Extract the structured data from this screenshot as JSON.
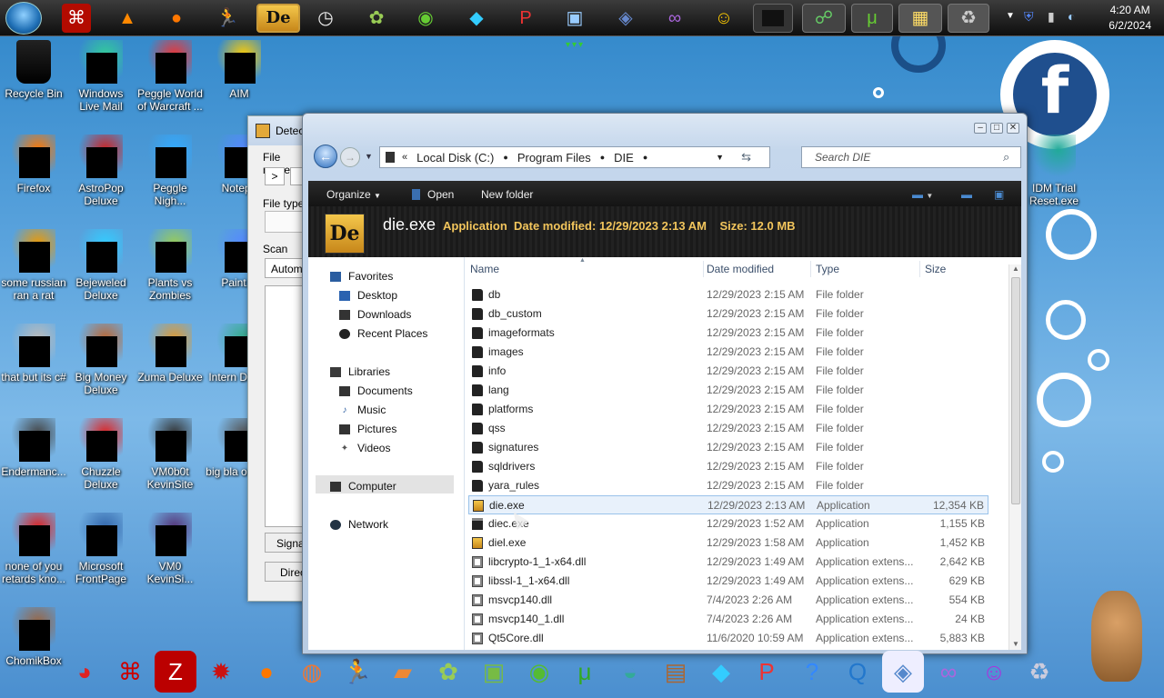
{
  "taskbar": {
    "time": "4:20 AM",
    "date": "6/2/2024",
    "icons": [
      "windows-orb-icon",
      "acrobat-icon",
      "vlc-icon",
      "firefox-icon",
      "aim-icon",
      "die-icon",
      "clock-icon",
      "plants-vs-zombies-icon",
      "windows-icon",
      "bejeweled-icon",
      "peggle-icon",
      "paint-icon",
      "frontpage-icon",
      "visual-studio-icon",
      "yahoo-messenger-icon",
      "terminal-icon",
      "users-icon",
      "utorrent-icon",
      "control-panel-icon",
      "recycle-icon"
    ]
  },
  "desktop_icons": [
    {
      "label": "Recycle Bin",
      "name": "recycle-bin"
    },
    {
      "label": "Windows Live Mail",
      "name": "windows-live-mail"
    },
    {
      "label": "Peggle World of Warcraft ...",
      "name": "peggle-wow"
    },
    {
      "label": "AIM",
      "name": "aim"
    },
    {
      "label": "Firefox",
      "name": "firefox"
    },
    {
      "label": "AstroPop Deluxe",
      "name": "astropop"
    },
    {
      "label": "Peggle Nigh...",
      "name": "peggle-nights"
    },
    {
      "label": "Notepa",
      "name": "notepad"
    },
    {
      "label": "some russian ran a rat",
      "name": "russian-rat"
    },
    {
      "label": "Bejeweled Deluxe",
      "name": "bejeweled"
    },
    {
      "label": "Plants vs Zombies",
      "name": "plants-vs-zombies"
    },
    {
      "label": "Paint.N",
      "name": "paint-net"
    },
    {
      "label": "that but its c#",
      "name": "that-but-csharp"
    },
    {
      "label": "Big Money Deluxe",
      "name": "big-money"
    },
    {
      "label": "Zuma Deluxe",
      "name": "zuma"
    },
    {
      "label": "Intern Downl",
      "name": "internet-download"
    },
    {
      "label": "Endermanc...",
      "name": "endermanch"
    },
    {
      "label": "Chuzzle Deluxe",
      "name": "chuzzle"
    },
    {
      "label": "VM0b0t KevinSite",
      "name": "vm0b0t"
    },
    {
      "label": "big bla occk.p",
      "name": "big-black"
    },
    {
      "label": "none of you retards kno...",
      "name": "none-of-you"
    },
    {
      "label": "Microsoft FrontPage",
      "name": "frontpage"
    },
    {
      "label": "VM0 KevinSi...",
      "name": "vm0"
    },
    {
      "label": "ChomikBox",
      "name": "chomikbox"
    },
    {
      "label": "IDM Trial Reset.exe",
      "name": "idm-trial-reset"
    }
  ],
  "background_window": {
    "title": "Detec",
    "file_name_label": "File name",
    "file_type_label": "File type",
    "scan_label": "Scan",
    "scan_value": "Automa",
    "sig_button": "Signat",
    "dir_button": "Direc"
  },
  "explorer": {
    "address": {
      "crumbs": [
        "Local Disk (C:)",
        "Program Files",
        "DIE"
      ]
    },
    "search_placeholder": "Search DIE",
    "toolbar": {
      "organize": "Organize",
      "open": "Open",
      "new_folder": "New folder"
    },
    "details": {
      "icon_text": "De",
      "file_name": "die.exe",
      "type": "Application",
      "date_modified_label": "Date modified:",
      "date_modified": "12/29/2023 2:13 AM",
      "size_label": "Size:",
      "size": "12.0 MB"
    },
    "nav": {
      "favorites": "Favorites",
      "desktop": "Desktop",
      "downloads": "Downloads",
      "recent": "Recent Places",
      "libraries": "Libraries",
      "documents": "Documents",
      "music": "Music",
      "pictures": "Pictures",
      "videos": "Videos",
      "computer": "Computer",
      "network": "Network"
    },
    "columns": {
      "name": "Name",
      "date": "Date modified",
      "type": "Type",
      "size": "Size"
    },
    "rows": [
      {
        "name": "db",
        "date": "12/29/2023 2:15 AM",
        "type": "File folder",
        "size": "",
        "kind": "folder"
      },
      {
        "name": "db_custom",
        "date": "12/29/2023 2:15 AM",
        "type": "File folder",
        "size": "",
        "kind": "folder"
      },
      {
        "name": "imageformats",
        "date": "12/29/2023 2:15 AM",
        "type": "File folder",
        "size": "",
        "kind": "folder"
      },
      {
        "name": "images",
        "date": "12/29/2023 2:15 AM",
        "type": "File folder",
        "size": "",
        "kind": "folder"
      },
      {
        "name": "info",
        "date": "12/29/2023 2:15 AM",
        "type": "File folder",
        "size": "",
        "kind": "folder"
      },
      {
        "name": "lang",
        "date": "12/29/2023 2:15 AM",
        "type": "File folder",
        "size": "",
        "kind": "folder"
      },
      {
        "name": "platforms",
        "date": "12/29/2023 2:15 AM",
        "type": "File folder",
        "size": "",
        "kind": "folder"
      },
      {
        "name": "qss",
        "date": "12/29/2023 2:15 AM",
        "type": "File folder",
        "size": "",
        "kind": "folder"
      },
      {
        "name": "signatures",
        "date": "12/29/2023 2:15 AM",
        "type": "File folder",
        "size": "",
        "kind": "folder"
      },
      {
        "name": "sqldrivers",
        "date": "12/29/2023 2:15 AM",
        "type": "File folder",
        "size": "",
        "kind": "folder"
      },
      {
        "name": "yara_rules",
        "date": "12/29/2023 2:15 AM",
        "type": "File folder",
        "size": "",
        "kind": "folder"
      },
      {
        "name": "die.exe",
        "date": "12/29/2023 2:13 AM",
        "type": "Application",
        "size": "12,354 KB",
        "kind": "die",
        "selected": true
      },
      {
        "name": "diec.exe",
        "date": "12/29/2023 1:52 AM",
        "type": "Application",
        "size": "1,155 KB",
        "kind": "console"
      },
      {
        "name": "diel.exe",
        "date": "12/29/2023 1:58 AM",
        "type": "Application",
        "size": "1,452 KB",
        "kind": "die"
      },
      {
        "name": "libcrypto-1_1-x64.dll",
        "date": "12/29/2023 1:49 AM",
        "type": "Application extens...",
        "size": "2,642 KB",
        "kind": "dll"
      },
      {
        "name": "libssl-1_1-x64.dll",
        "date": "12/29/2023 1:49 AM",
        "type": "Application extens...",
        "size": "629 KB",
        "kind": "dll"
      },
      {
        "name": "msvcp140.dll",
        "date": "7/4/2023 2:26 AM",
        "type": "Application extens...",
        "size": "554 KB",
        "kind": "dll"
      },
      {
        "name": "msvcp140_1.dll",
        "date": "7/4/2023 2:26 AM",
        "type": "Application extens...",
        "size": "24 KB",
        "kind": "dll"
      },
      {
        "name": "Qt5Core.dll",
        "date": "11/6/2020 10:59 AM",
        "type": "Application extens...",
        "size": "5,883 KB",
        "kind": "dll"
      }
    ]
  },
  "dock_icons": [
    "chuzzle-icon",
    "acrobat-icon",
    "filezilla-icon",
    "chuzzle-red-icon",
    "firefox-icon",
    "opera-icon",
    "aim-icon",
    "die-icon",
    "plants-vs-zombies-icon",
    "paint-icon",
    "windows-icon",
    "utorrent-icon",
    "idm-icon",
    "chomikbox-icon",
    "bejeweled-icon",
    "peggle-icon",
    "help-icon",
    "quicktime-icon",
    "frontpage-icon",
    "visual-studio-icon",
    "yahoo-icon",
    "recycle-bin-icon"
  ],
  "colors": {
    "accent": "#f2c55c",
    "selection": "#e8f1fb",
    "desktop": "#4b8fcf"
  }
}
